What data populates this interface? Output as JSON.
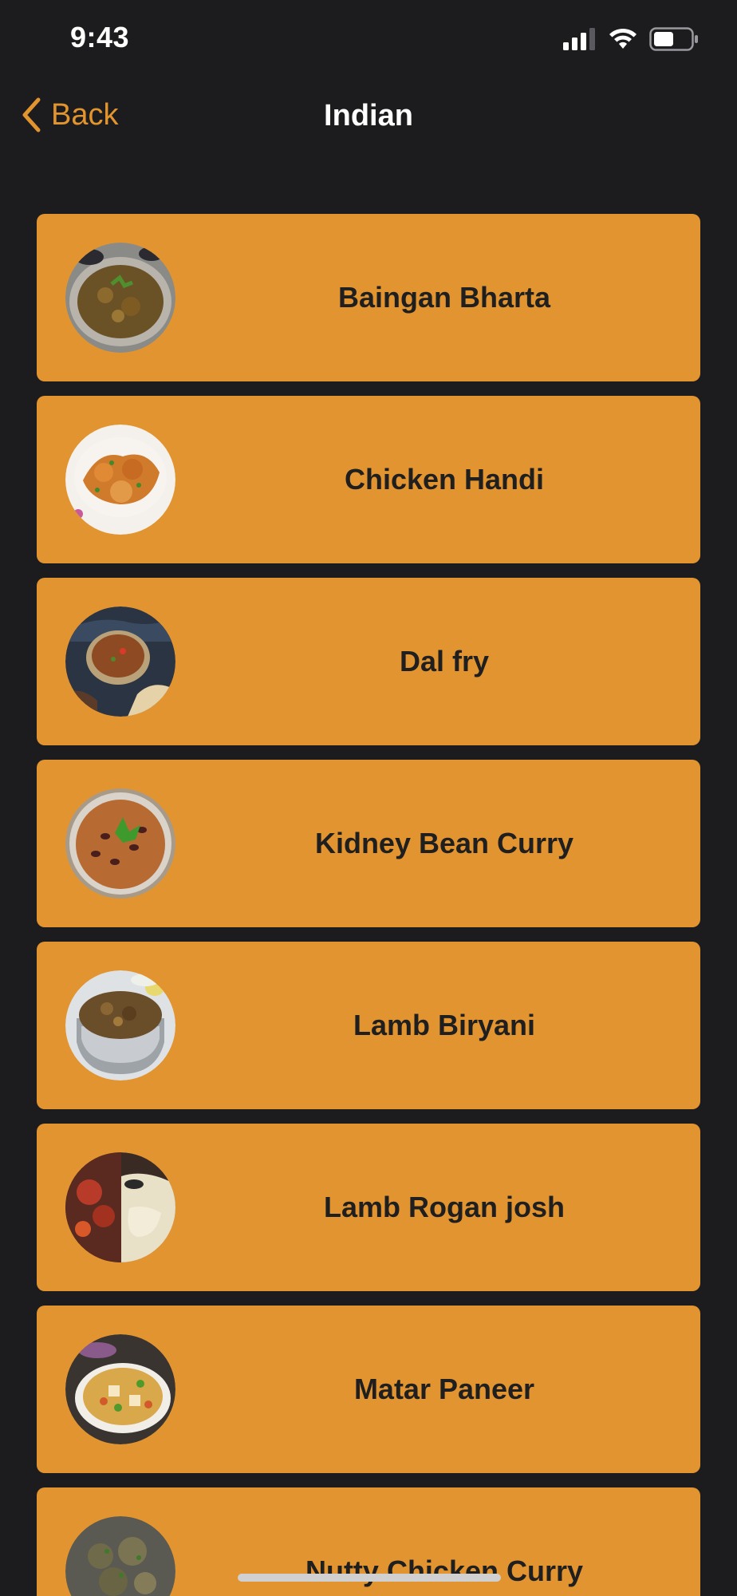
{
  "status_bar": {
    "time": "9:43"
  },
  "nav": {
    "back_label": "Back",
    "title": "Indian"
  },
  "colors": {
    "background": "#1c1c1e",
    "accent": "#e2942f",
    "card": "#e29431",
    "card_text": "#1f1f1f"
  },
  "recipes": [
    {
      "name": "Baingan Bharta",
      "image": "baingan-bharta-photo"
    },
    {
      "name": "Chicken Handi",
      "image": "chicken-handi-photo"
    },
    {
      "name": "Dal fry",
      "image": "dal-fry-photo"
    },
    {
      "name": "Kidney Bean Curry",
      "image": "kidney-bean-curry-photo"
    },
    {
      "name": "Lamb Biryani",
      "image": "lamb-biryani-photo"
    },
    {
      "name": "Lamb Rogan josh",
      "image": "lamb-rogan-josh-photo"
    },
    {
      "name": "Matar Paneer",
      "image": "matar-paneer-photo"
    },
    {
      "name": "Nutty Chicken Curry",
      "image": "nutty-chicken-curry-photo"
    }
  ]
}
